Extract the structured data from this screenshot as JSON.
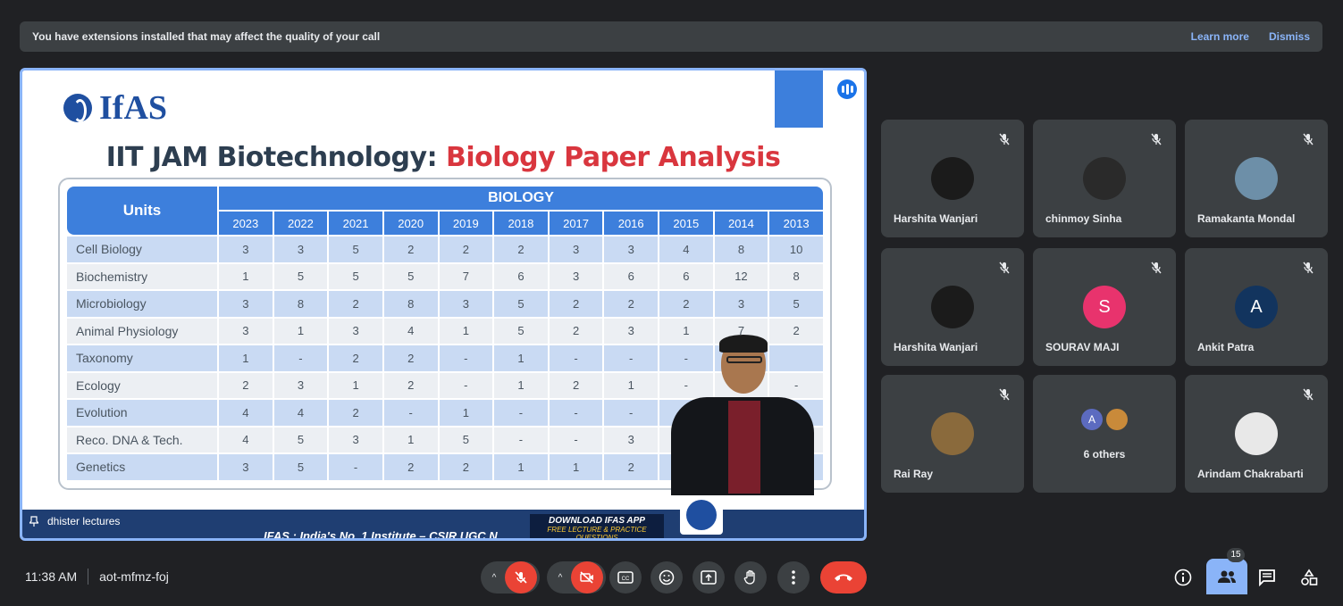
{
  "banner": {
    "message": "You have extensions installed that may affect the quality of your call",
    "learn_more": "Learn more",
    "dismiss": "Dismiss"
  },
  "presentation": {
    "presenter_name": "dhister lectures",
    "slide": {
      "logo_text": "IfAS",
      "title_part1": "IIT JAM Biotechnology:",
      "title_part2": "Biology Paper Analysis",
      "table": {
        "units_header": "Units",
        "group_header": "BIOLOGY",
        "years": [
          "2023",
          "2022",
          "2021",
          "2020",
          "2019",
          "2018",
          "2017",
          "2016",
          "2015",
          "2014",
          "2013"
        ],
        "rows": [
          {
            "unit": "Cell Biology",
            "values": [
              "3",
              "3",
              "5",
              "2",
              "2",
              "2",
              "3",
              "3",
              "4",
              "8",
              "10"
            ]
          },
          {
            "unit": "Biochemistry",
            "values": [
              "1",
              "5",
              "5",
              "5",
              "7",
              "6",
              "3",
              "6",
              "6",
              "12",
              "8"
            ]
          },
          {
            "unit": "Microbiology",
            "values": [
              "3",
              "8",
              "2",
              "8",
              "3",
              "5",
              "2",
              "2",
              "2",
              "3",
              "5"
            ]
          },
          {
            "unit": "Animal Physiology",
            "values": [
              "3",
              "1",
              "3",
              "4",
              "1",
              "5",
              "2",
              "3",
              "1",
              "7",
              "2"
            ]
          },
          {
            "unit": "Taxonomy",
            "values": [
              "1",
              "-",
              "2",
              "2",
              "-",
              "1",
              "-",
              "-",
              "-",
              "",
              ""
            ]
          },
          {
            "unit": "Ecology",
            "values": [
              "2",
              "3",
              "1",
              "2",
              "-",
              "1",
              "2",
              "1",
              "-",
              "",
              "-"
            ]
          },
          {
            "unit": "Evolution",
            "values": [
              "4",
              "4",
              "2",
              "-",
              "1",
              "-",
              "-",
              "-",
              "1",
              "",
              "1"
            ]
          },
          {
            "unit": "Reco. DNA & Tech.",
            "values": [
              "4",
              "5",
              "3",
              "1",
              "5",
              "-",
              "-",
              "3",
              "",
              "",
              ""
            ]
          },
          {
            "unit": "Genetics",
            "values": [
              "3",
              "5",
              "-",
              "2",
              "2",
              "1",
              "1",
              "2",
              "",
              "",
              ""
            ]
          }
        ]
      },
      "ticker": "IFAS : India's No. 1 Institute – CSIR UGC N",
      "download_line1": "DOWNLOAD IFAS APP",
      "download_line2": "FREE LECTURE & PRACTICE QUESTIONS"
    }
  },
  "participants": [
    {
      "name": "Harshita Wanjari",
      "avatar_color": "#1b1b1b",
      "icon": "mic-off-icon"
    },
    {
      "name": "chinmoy Sinha",
      "avatar_color": "#2a2a2a",
      "icon": "mic-off-icon"
    },
    {
      "name": "Ramakanta Mondal",
      "avatar_color": "#6d8fa8",
      "icon": "mic-off-icon"
    },
    {
      "name": "Harshita Wanjari",
      "avatar_color": "#1b1b1b",
      "icon": "mic-off-icon"
    },
    {
      "name": "SOURAV MAJI",
      "avatar_letter": "S",
      "avatar_color": "#e8336d",
      "icon": "mic-off-icon"
    },
    {
      "name": "Ankit Patra",
      "avatar_letter": "A",
      "avatar_color": "#12345e",
      "icon": "mic-off-icon"
    },
    {
      "name": "Rai Ray",
      "avatar_color": "#8a6a3c",
      "icon": "mic-off-icon"
    },
    {
      "name": "6 others",
      "avatar_letter": "A",
      "avatar_color": "#5c6bc0"
    },
    {
      "name": "Arindam Chakrabarti",
      "avatar_color": "#e8e8e8",
      "icon": "mic-off-icon"
    }
  ],
  "bottom_bar": {
    "time": "11:38 AM",
    "meeting_code": "aot-mfmz-foj",
    "people_count": "15",
    "colors": {
      "danger": "#ea4335",
      "accent": "#8ab4f8",
      "button": "#3c4043"
    }
  }
}
